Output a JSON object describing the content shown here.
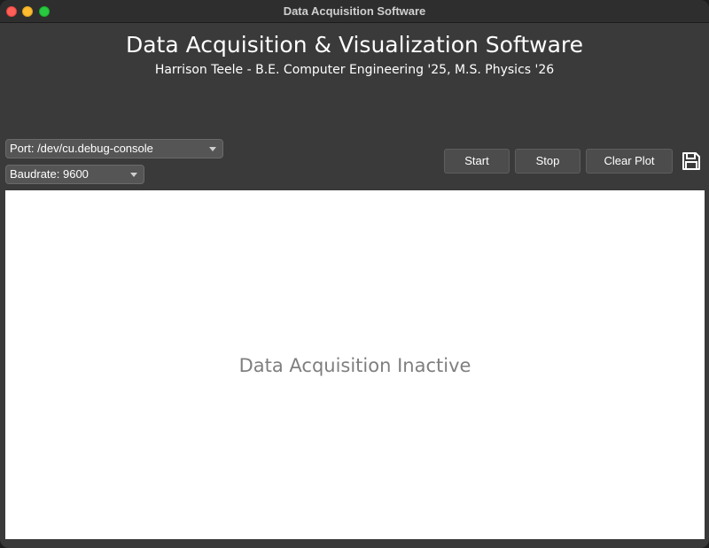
{
  "window": {
    "title": "Data Acquisition Software"
  },
  "header": {
    "title": "Data Acquisition & Visualization Software",
    "subtitle": "Harrison Teele - B.E. Computer Engineering '25, M.S. Physics '26"
  },
  "controls": {
    "port_value": "Port: /dev/cu.debug-console",
    "baudrate_value": "Baudrate: 9600",
    "start_label": "Start",
    "stop_label": "Stop",
    "clear_label": "Clear Plot",
    "save_icon": "floppy-disk-icon"
  },
  "plot": {
    "status_text": "Data Acquisition Inactive",
    "background": "#ffffff"
  },
  "colors": {
    "window_bg": "#3a3a3a",
    "close": "#ff5f57",
    "minimize": "#febc2e",
    "maximize": "#28c840"
  }
}
